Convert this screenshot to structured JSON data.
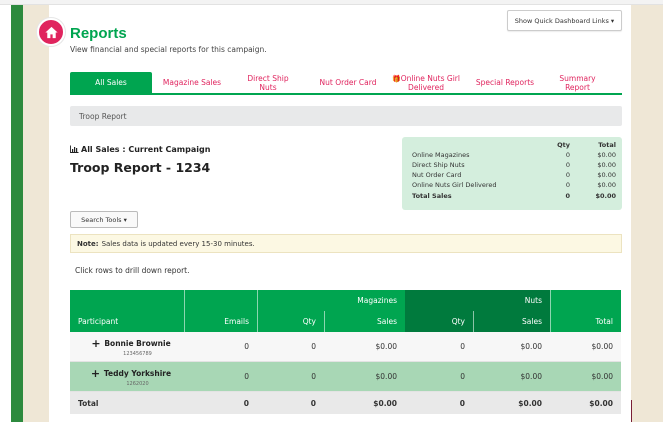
{
  "page": {
    "title": "Reports",
    "subtitle": "View financial and special reports for this campaign.",
    "quick_links_label": "Show Quick Dashboard Links ▾",
    "home_icon": "home-icon"
  },
  "tabs": [
    {
      "label": "All Sales",
      "active": true
    },
    {
      "label": "Magazine Sales",
      "active": false
    },
    {
      "label": "Direct Ship Nuts",
      "active": false
    },
    {
      "label": "Nut Order Card",
      "active": false
    },
    {
      "label": "Online Nuts Girl Delivered",
      "active": false,
      "icon": "gift-icon"
    },
    {
      "label": "Special Reports",
      "active": false
    },
    {
      "label": "Summary Report",
      "active": false
    }
  ],
  "breadcrumb": "Troop Report",
  "section": {
    "label": "All Sales : Current Campaign",
    "report_title": "Troop Report - 1234"
  },
  "summary": {
    "headers": {
      "qty": "Qty",
      "total": "Total"
    },
    "rows": [
      {
        "label": "Online Magazines",
        "qty": "0",
        "total": "$0.00"
      },
      {
        "label": "Direct Ship Nuts",
        "qty": "0",
        "total": "$0.00"
      },
      {
        "label": "Nut Order Card",
        "qty": "0",
        "total": "$0.00"
      },
      {
        "label": "Online Nuts Girl Delivered",
        "qty": "0",
        "total": "$0.00"
      },
      {
        "label": "Total Sales",
        "qty": "0",
        "total": "$0.00",
        "bold": true
      }
    ]
  },
  "search_tools": "Search Tools ▾",
  "note": {
    "label": "Note:",
    "text": "Sales data is updated every 15-30 minutes."
  },
  "instructions": "Click rows to drill down report.",
  "table": {
    "group_headers": {
      "magazines": "Magazines",
      "nuts": "Nuts"
    },
    "columns": [
      "Participant",
      "Emails",
      "Qty",
      "Sales",
      "Qty",
      "Sales",
      "Total"
    ],
    "rows": [
      {
        "name": "Bonnie Brownie",
        "id": "123456789",
        "emails": "0",
        "mag_qty": "0",
        "mag_sales": "$0.00",
        "nuts_qty": "0",
        "nuts_sales": "$0.00",
        "total": "$0.00"
      },
      {
        "name": "Teddy Yorkshire",
        "id": "1262020",
        "emails": "0",
        "mag_qty": "0",
        "mag_sales": "$0.00",
        "nuts_qty": "0",
        "nuts_sales": "$0.00",
        "total": "$0.00"
      }
    ],
    "total_row": {
      "label": "Total",
      "emails": "0",
      "mag_qty": "0",
      "mag_sales": "$0.00",
      "nuts_qty": "0",
      "nuts_sales": "$0.00",
      "total": "$0.00"
    }
  },
  "colors": {
    "brand_green": "#00a550",
    "dark_green": "#007a3d",
    "accent_pink": "#e0245e",
    "summary_bg": "#d4eedd"
  }
}
